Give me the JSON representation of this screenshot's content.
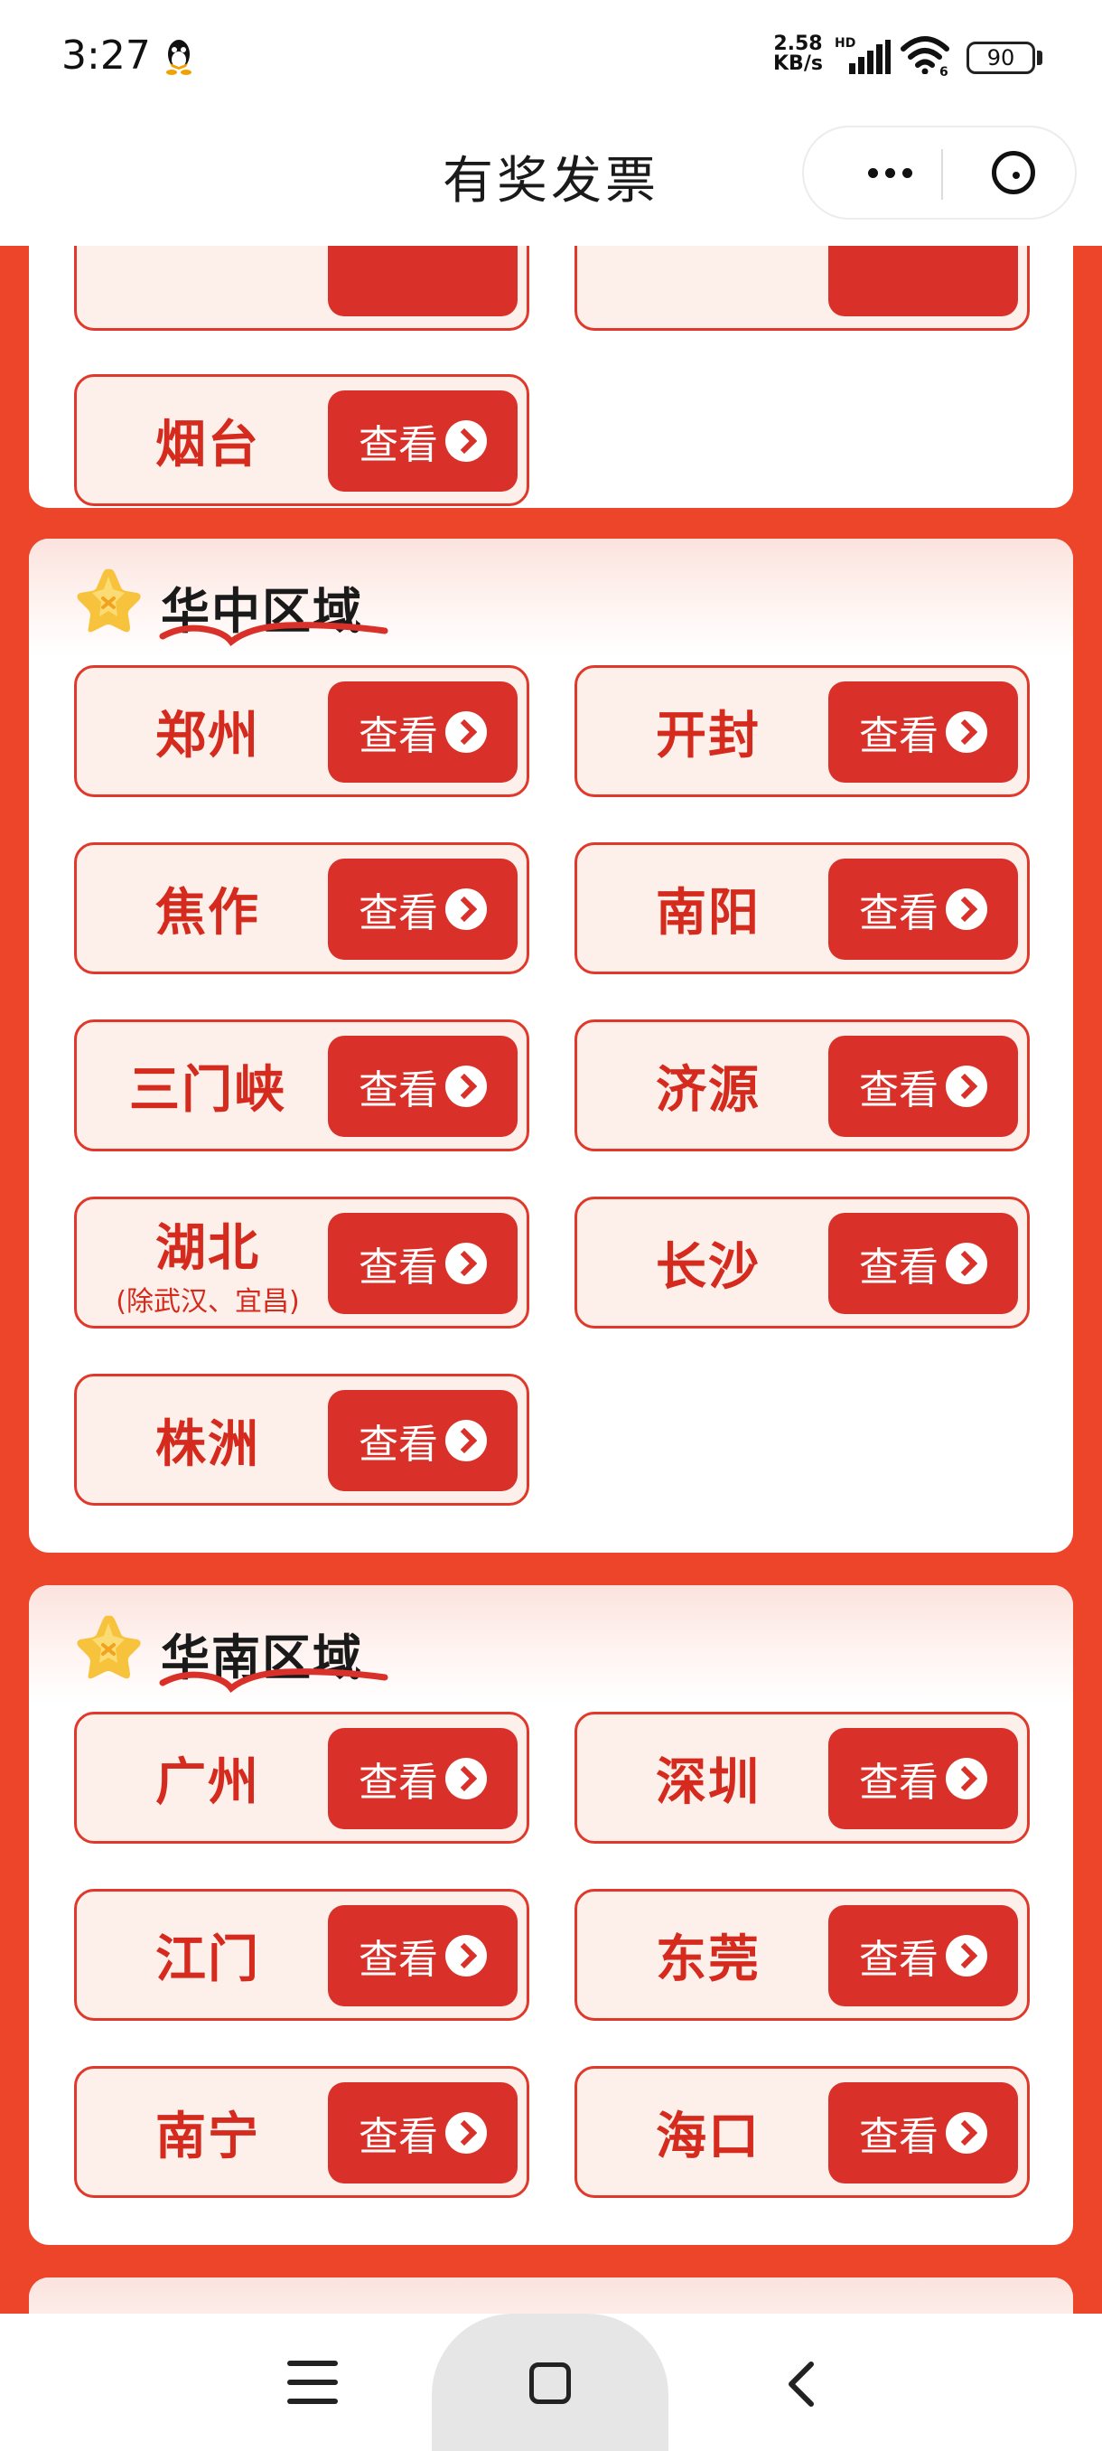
{
  "status_bar": {
    "time": "3:27",
    "net_speed_value": "2.58",
    "net_speed_unit": "KB/s",
    "hd_label": "HD",
    "wifi_sub": "6",
    "battery": "90",
    "icons": [
      "qq-icon",
      "signal-icon",
      "wifi-icon",
      "battery-icon"
    ]
  },
  "header": {
    "title": "有奖发票",
    "more_icon": "more-dots-icon",
    "close_icon": "close-circle-icon"
  },
  "view_label": "查看",
  "view_icon": "chevron-right-circle-icon",
  "top_card": {
    "cities": [
      {
        "name": "烟台"
      }
    ]
  },
  "regions": [
    {
      "title": "华中区域",
      "icon": "star-icon",
      "cities": [
        {
          "name": "郑州"
        },
        {
          "name": "开封"
        },
        {
          "name": "焦作"
        },
        {
          "name": "南阳"
        },
        {
          "name": "三门峡"
        },
        {
          "name": "济源"
        },
        {
          "name": "湖北",
          "sub": "(除武汉、宜昌)"
        },
        {
          "name": "长沙"
        },
        {
          "name": "株洲"
        }
      ]
    },
    {
      "title": "华南区域",
      "icon": "star-icon",
      "cities": [
        {
          "name": "广州"
        },
        {
          "name": "深圳"
        },
        {
          "name": "江门"
        },
        {
          "name": "东莞"
        },
        {
          "name": "南宁"
        },
        {
          "name": "海口"
        }
      ]
    }
  ],
  "bottom_nav": {
    "icons": [
      "menu-icon",
      "home-icon",
      "back-icon"
    ]
  },
  "colors": {
    "page_background": "#ec452a",
    "button_red": "#d9302a",
    "city_text": "#d52b1e",
    "city_bg": "#fdf0ea"
  }
}
